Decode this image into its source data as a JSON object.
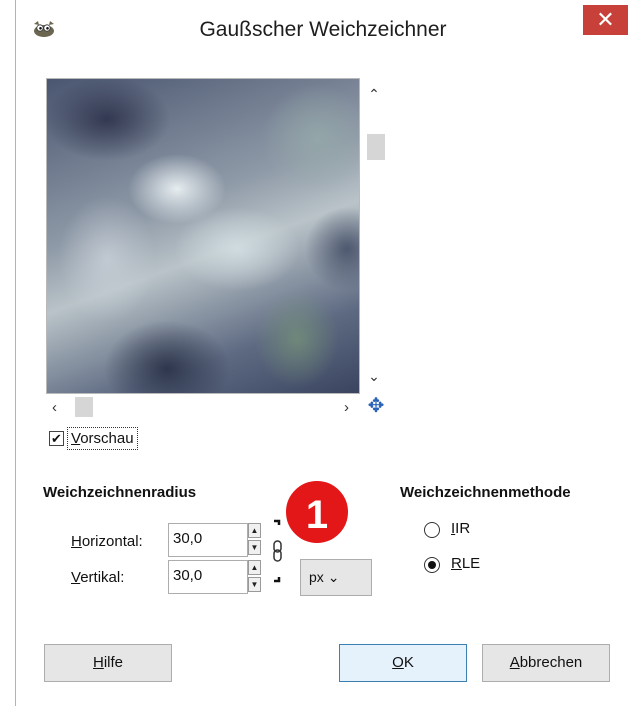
{
  "window": {
    "title": "Gaußscher Weichzeichner",
    "close_glyph": "✕",
    "app_icon": "gimp-wilber-icon"
  },
  "preview": {
    "checkbox_label_underline": "V",
    "checkbox_label_rest": "orschau",
    "checked": true
  },
  "radius": {
    "section_title": "Weichzeichnenradius",
    "horizontal_label_underline": "H",
    "horizontal_label_rest": "orizontal:",
    "horizontal_value": "30,0",
    "vertical_label_underline": "V",
    "vertical_label_rest": "ertikal:",
    "vertical_value": "30,0",
    "unit": "px",
    "unit_chevron": "⌄",
    "chain_icon": "chain-link-icon"
  },
  "method": {
    "section_title": "Weichzeichnenmethode",
    "options": [
      {
        "label_underline": "I",
        "label_rest": "IR",
        "checked": false
      },
      {
        "label_underline": "R",
        "label_rest": "LE",
        "checked": true
      }
    ]
  },
  "annotation": {
    "badge_number": "1",
    "badge_color": "#e31717"
  },
  "buttons": {
    "help_underline": "H",
    "help_rest": "ilfe",
    "ok_underline": "O",
    "ok_rest": "K",
    "cancel_underline": "A",
    "cancel_rest": "bbrechen"
  },
  "colors": {
    "close_button": "#c7413a",
    "default_button_border": "#3c7fb1"
  }
}
